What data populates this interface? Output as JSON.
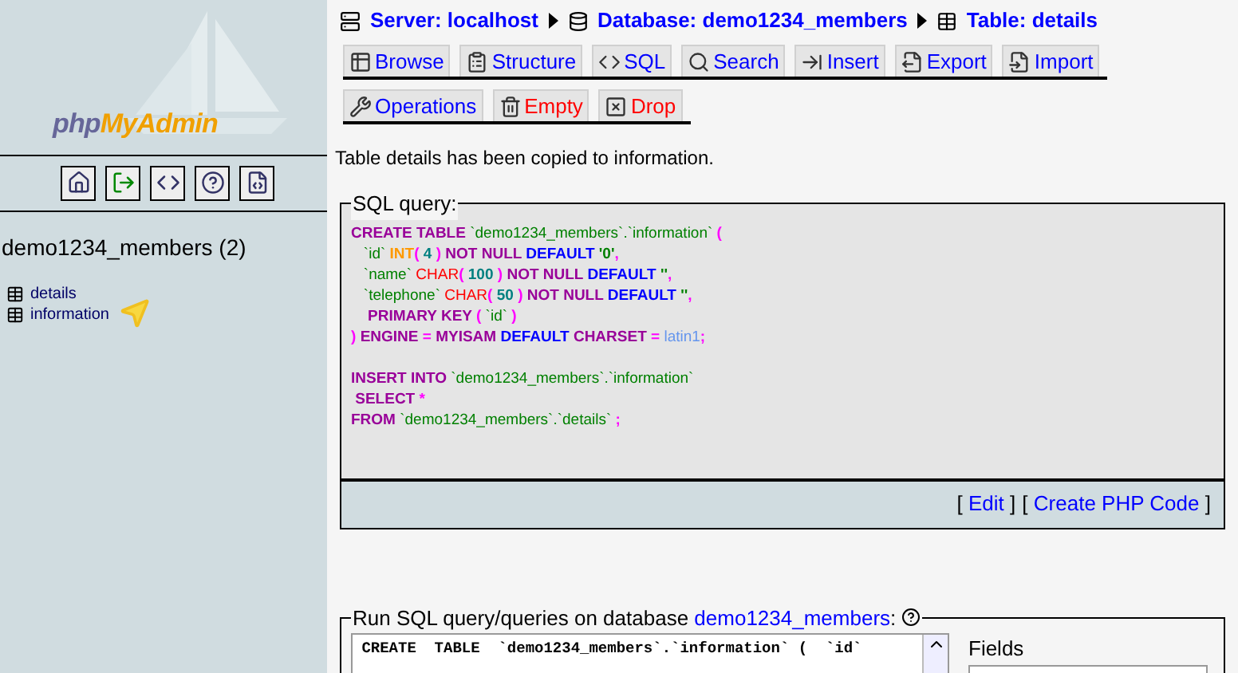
{
  "sidebar": {
    "logo": {
      "prefix": "php",
      "suffix": "MyAdmin"
    },
    "icon_buttons": [
      {
        "kind": "home"
      },
      {
        "kind": "exit"
      },
      {
        "kind": "sql-window"
      },
      {
        "kind": "help"
      },
      {
        "kind": "sql-doc"
      }
    ],
    "database": "demo1234_members (2)",
    "tables": [
      {
        "name": "details"
      },
      {
        "name": "information"
      }
    ]
  },
  "breadcrumb": [
    {
      "kind": "server",
      "label": "Server: localhost"
    },
    {
      "kind": "database",
      "label": "Database: demo1234_members"
    },
    {
      "kind": "table",
      "label": "Table: details"
    }
  ],
  "tabs": [
    [
      {
        "kind": "browse",
        "label": "Browse",
        "danger": false
      },
      {
        "kind": "structure",
        "label": "Structure",
        "danger": false
      },
      {
        "kind": "sql",
        "label": "SQL",
        "danger": false
      },
      {
        "kind": "search",
        "label": "Search",
        "danger": false
      },
      {
        "kind": "insert",
        "label": "Insert",
        "danger": false
      },
      {
        "kind": "export",
        "label": "Export",
        "danger": false
      },
      {
        "kind": "import",
        "label": "Import",
        "danger": false
      }
    ],
    [
      {
        "kind": "operations",
        "label": "Operations",
        "danger": false
      },
      {
        "kind": "empty",
        "label": "Empty",
        "danger": true
      },
      {
        "kind": "drop",
        "label": "Drop",
        "danger": true
      }
    ]
  ],
  "message": "Table details has been copied to information.",
  "sql_query": {
    "legend": "SQL query:",
    "statements": [
      [
        [
          {
            "text": "CREATE TABLE ",
            "color": "#990099"
          },
          {
            "text": "`demo1234_members`.`information`",
            "color": "#008000"
          },
          {
            "text": " (",
            "color": "#ff00ff"
          }
        ],
        [
          {
            "text": "   `id` ",
            "color": "#008000"
          },
          {
            "text": "INT",
            "color": "#ff9900"
          },
          {
            "text": "( ",
            "color": "#ff00ff"
          },
          {
            "text": "4",
            "color": "#008080"
          },
          {
            "text": " ) ",
            "color": "#ff00ff"
          },
          {
            "text": "NOT NULL ",
            "color": "#990099"
          },
          {
            "text": "DEFAULT ",
            "color": "#0000ff"
          },
          {
            "text": "'0'",
            "color": "#008000"
          },
          {
            "text": ",",
            "color": "#ff00ff"
          }
        ],
        [
          {
            "text": "   `name` ",
            "color": "#008000"
          },
          {
            "text": "CHAR",
            "color": "#ff0000"
          },
          {
            "text": "( ",
            "color": "#ff00ff"
          },
          {
            "text": "100",
            "color": "#008080"
          },
          {
            "text": " ) ",
            "color": "#ff00ff"
          },
          {
            "text": "NOT NULL ",
            "color": "#990099"
          },
          {
            "text": "DEFAULT ",
            "color": "#0000ff"
          },
          {
            "text": "''",
            "color": "#008000"
          },
          {
            "text": ",",
            "color": "#ff00ff"
          }
        ],
        [
          {
            "text": "   `telephone` ",
            "color": "#008000"
          },
          {
            "text": "CHAR",
            "color": "#ff0000"
          },
          {
            "text": "( ",
            "color": "#ff00ff"
          },
          {
            "text": "50",
            "color": "#008080"
          },
          {
            "text": " ) ",
            "color": "#ff00ff"
          },
          {
            "text": "NOT NULL ",
            "color": "#990099"
          },
          {
            "text": "DEFAULT ",
            "color": "#0000ff"
          },
          {
            "text": "''",
            "color": "#008000"
          },
          {
            "text": ",",
            "color": "#ff00ff"
          }
        ],
        [
          {
            "text": "    PRIMARY KEY ",
            "color": "#990099"
          },
          {
            "text": "( ",
            "color": "#ff00ff"
          },
          {
            "text": "`id`",
            "color": "#008000"
          },
          {
            "text": " )",
            "color": "#ff00ff"
          }
        ],
        [
          {
            "text": ") ",
            "color": "#ff00ff"
          },
          {
            "text": "ENGINE ",
            "color": "#990099"
          },
          {
            "text": "= ",
            "color": "#ff00ff"
          },
          {
            "text": "MYISAM ",
            "color": "#990099"
          },
          {
            "text": "DEFAULT ",
            "color": "#0000ff"
          },
          {
            "text": "CHARSET ",
            "color": "#990099"
          },
          {
            "text": "= ",
            "color": "#ff00ff"
          },
          {
            "text": "latin1",
            "color": "#6495ed"
          },
          {
            "text": ";",
            "color": "#ff00ff"
          }
        ]
      ],
      [
        [
          {
            "text": "INSERT INTO ",
            "color": "#990099"
          },
          {
            "text": "`demo1234_members`.`information`",
            "color": "#008000"
          }
        ],
        [
          {
            "text": " SELECT ",
            "color": "#990099"
          },
          {
            "text": "*",
            "color": "#ff00ff"
          }
        ],
        [
          {
            "text": "FROM ",
            "color": "#990099"
          },
          {
            "text": "`demo1234_members`.`details`",
            "color": "#008000"
          },
          {
            "text": " ;",
            "color": "#ff00ff"
          }
        ]
      ]
    ],
    "links": [
      {
        "open": "[",
        "label": "Edit",
        "close": "]"
      },
      {
        "open": "[",
        "label": "Create PHP Code",
        "close": "]"
      }
    ]
  },
  "run_sql": {
    "legend": "Run SQL query/queries on database",
    "database": "demo1234_members",
    "legend_end": ":",
    "textarea_value": " CREATE  TABLE  `demo1234_members`.`information` (  `id`",
    "fields_label": "Fields"
  }
}
